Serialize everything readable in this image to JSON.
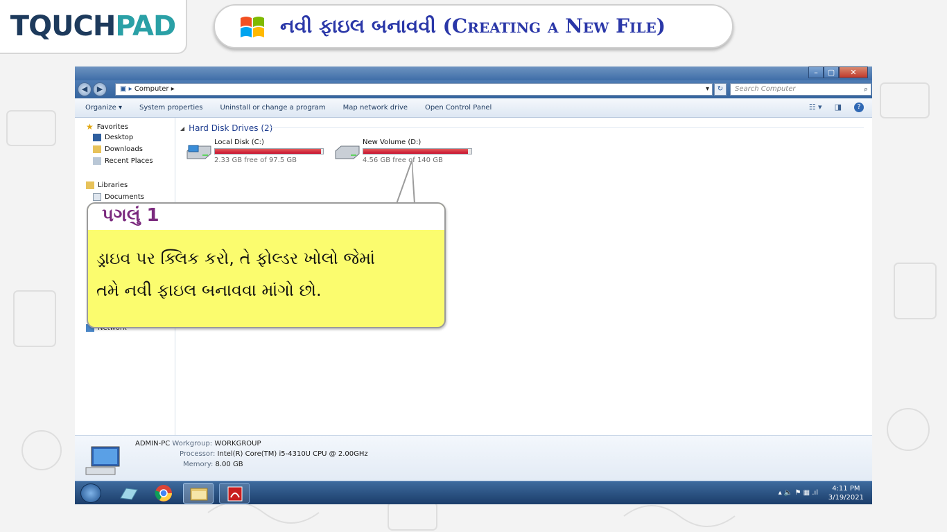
{
  "logo": {
    "touch": "TQUCH",
    "pad": "PAD"
  },
  "header": {
    "title": "નવી ફાઇલ બનાવવી (Creating a New File)"
  },
  "explorer": {
    "address": "Computer",
    "search_placeholder": "Search Computer",
    "toolbar": [
      "Organize ▾",
      "System properties",
      "Uninstall or change a program",
      "Map network drive",
      "Open Control Panel"
    ],
    "nav": {
      "favorites": "Favorites",
      "desktop": "Desktop",
      "downloads": "Downloads",
      "recent": "Recent Places",
      "libraries": "Libraries",
      "documents": "Documents",
      "network": "Network"
    },
    "group_header": "Hard Disk Drives (2)",
    "drives": [
      {
        "name": "Local Disk (C:)",
        "free": "2.33 GB free of 97.5 GB",
        "used_fraction": 0.98
      },
      {
        "name": "New Volume (D:)",
        "free": "4.56 GB free of 140 GB",
        "used_fraction": 0.97
      }
    ],
    "details": {
      "pc_name": "ADMIN-PC",
      "workgroup_label": "Workgroup:",
      "workgroup": "WORKGROUP",
      "processor_label": "Processor:",
      "processor": "Intel(R) Core(TM) i5-4310U CPU @ 2.00GHz",
      "memory_label": "Memory:",
      "memory": "8.00 GB"
    }
  },
  "taskbar": {
    "time": "4:11 PM",
    "date": "3/19/2021",
    "tray_icons": "▴ 🔈 ⚑ ▦ .ıl"
  },
  "callout": {
    "step": "પગલું 1",
    "line1": "ડ્રાઇવ પર ક્લિક કરો, તે ફોલ્ડર ખોલો જેમાં",
    "line2": "તમે નવી ફાઇલ બનાવવા માંગો છો."
  },
  "colors": {
    "title_blue": "#2a37a8",
    "logo_navy": "#1d3a5c",
    "logo_teal": "#2aa0a6",
    "callout_yellow": "#fbfc6e",
    "step_purple": "#7b2a7e",
    "drive_red": "#c8102e"
  }
}
